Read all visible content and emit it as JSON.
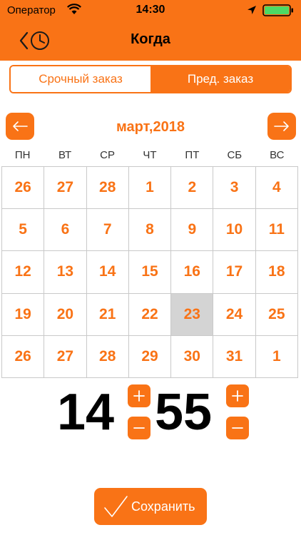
{
  "status_bar": {
    "carrier": "Оператор",
    "time": "14:30"
  },
  "nav": {
    "title": "Когда",
    "back_icon": "back-clock-icon"
  },
  "tabs": [
    {
      "label": "Срочный заказ",
      "active": false
    },
    {
      "label": "Пред. заказ",
      "active": true
    }
  ],
  "calendar": {
    "month_label": "март,2018",
    "weekdays": [
      "ПН",
      "ВТ",
      "СР",
      "ЧТ",
      "ПТ",
      "СБ",
      "ВС"
    ],
    "weeks": [
      [
        "26",
        "27",
        "28",
        "1",
        "2",
        "3",
        "4"
      ],
      [
        "5",
        "6",
        "7",
        "8",
        "9",
        "10",
        "11"
      ],
      [
        "12",
        "13",
        "14",
        "15",
        "16",
        "17",
        "18"
      ],
      [
        "19",
        "20",
        "21",
        "22",
        "23",
        "24",
        "25"
      ],
      [
        "26",
        "27",
        "28",
        "29",
        "30",
        "31",
        "1"
      ]
    ],
    "selected_day": "23"
  },
  "time_picker": {
    "hours": "14",
    "minutes": "55",
    "plus": "+",
    "minus": "−"
  },
  "save_button": {
    "label": "Сохранить"
  },
  "colors": {
    "accent": "#f97316",
    "selected_cell": "#d4d4d4",
    "grid_line": "#c9c9c9"
  }
}
